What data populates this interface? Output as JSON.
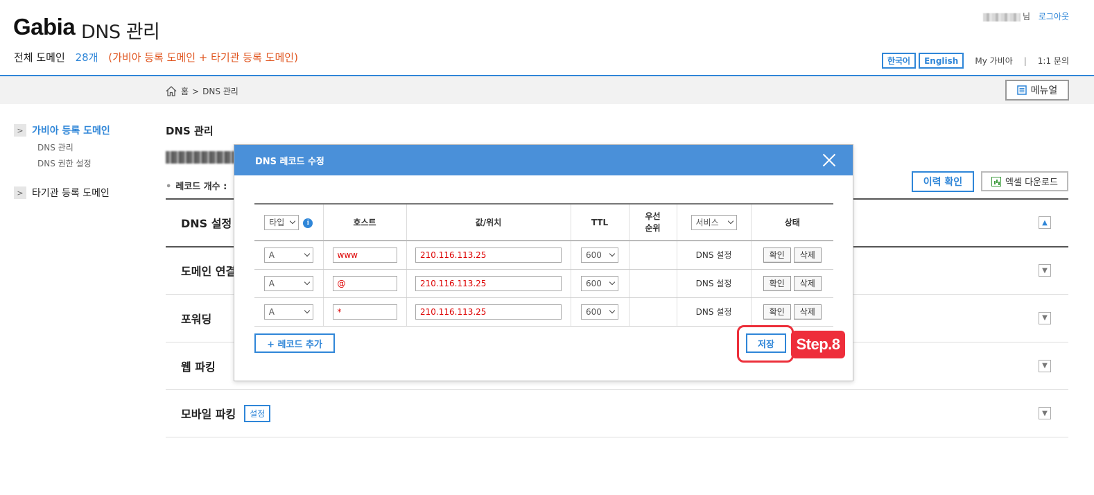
{
  "header": {
    "brand": "Gabia",
    "brand_sub": "DNS 관리",
    "domain_label": "전체 도메인",
    "domain_count": "28개",
    "domain_note": "(가비아 등록 도메인 + 타기관 등록 도메인)",
    "user_suffix": "님",
    "logout": "로그아웃",
    "lang_korean": "한국어",
    "lang_english": "English",
    "my_gabia": "My 가비아",
    "separator": "|",
    "inquiry": "1:1 문의"
  },
  "breadcrumb": {
    "home": "홈",
    "arrow": ">",
    "current": "DNS 관리",
    "manual_button": "메뉴얼"
  },
  "sidebar": {
    "group1": {
      "label": "가비아 등록 도메인",
      "arrow": ">"
    },
    "group1_items": [
      "DNS 관리",
      "DNS 권한 설정"
    ],
    "group2": {
      "label": "타기관 등록 도메인",
      "arrow": ">"
    }
  },
  "main": {
    "title": "DNS 관리",
    "record_count_label": "레코드 개수 :",
    "record_dot": "•",
    "history_button": "이력 확인",
    "excel_button": "엑셀 다운로드",
    "sections": [
      {
        "label": "DNS 설정",
        "toggle": "▲"
      },
      {
        "label": "도메인 연결",
        "toggle": "▼"
      },
      {
        "label": "포워딩",
        "toggle": "▼"
      },
      {
        "label": "웹 파킹",
        "toggle": "▼"
      },
      {
        "label": "모바일 파킹",
        "toggle": "▼",
        "badge": "설정"
      }
    ]
  },
  "modal": {
    "title": "DNS 레코드 수정",
    "columns": {
      "type": "타입",
      "info": "i",
      "host": "호스트",
      "value": "값/위치",
      "ttl": "TTL",
      "priority": "우선 순위",
      "service": "서비스",
      "status": "상태"
    },
    "rows": [
      {
        "type": "A",
        "host": "www",
        "value": "210.116.113.25",
        "ttl": "600",
        "priority": "",
        "service": "DNS 설정",
        "confirm": "확인",
        "delete": "삭제"
      },
      {
        "type": "A",
        "host": "@",
        "value": "210.116.113.25",
        "ttl": "600",
        "priority": "",
        "service": "DNS 설정",
        "confirm": "확인",
        "delete": "삭제"
      },
      {
        "type": "A",
        "host": "*",
        "value": "210.116.113.25",
        "ttl": "600",
        "priority": "",
        "service": "DNS 설정",
        "confirm": "확인",
        "delete": "삭제"
      }
    ],
    "add_button": "+ 레코드 추가",
    "save_button": "저장",
    "step_label": "Step.8"
  },
  "colors": {
    "accent": "#2f86d8",
    "modal_header": "#4a90d9",
    "note_orange": "#e0551f",
    "annotation_red": "#ee2e3b",
    "value_red": "#dd0000"
  }
}
